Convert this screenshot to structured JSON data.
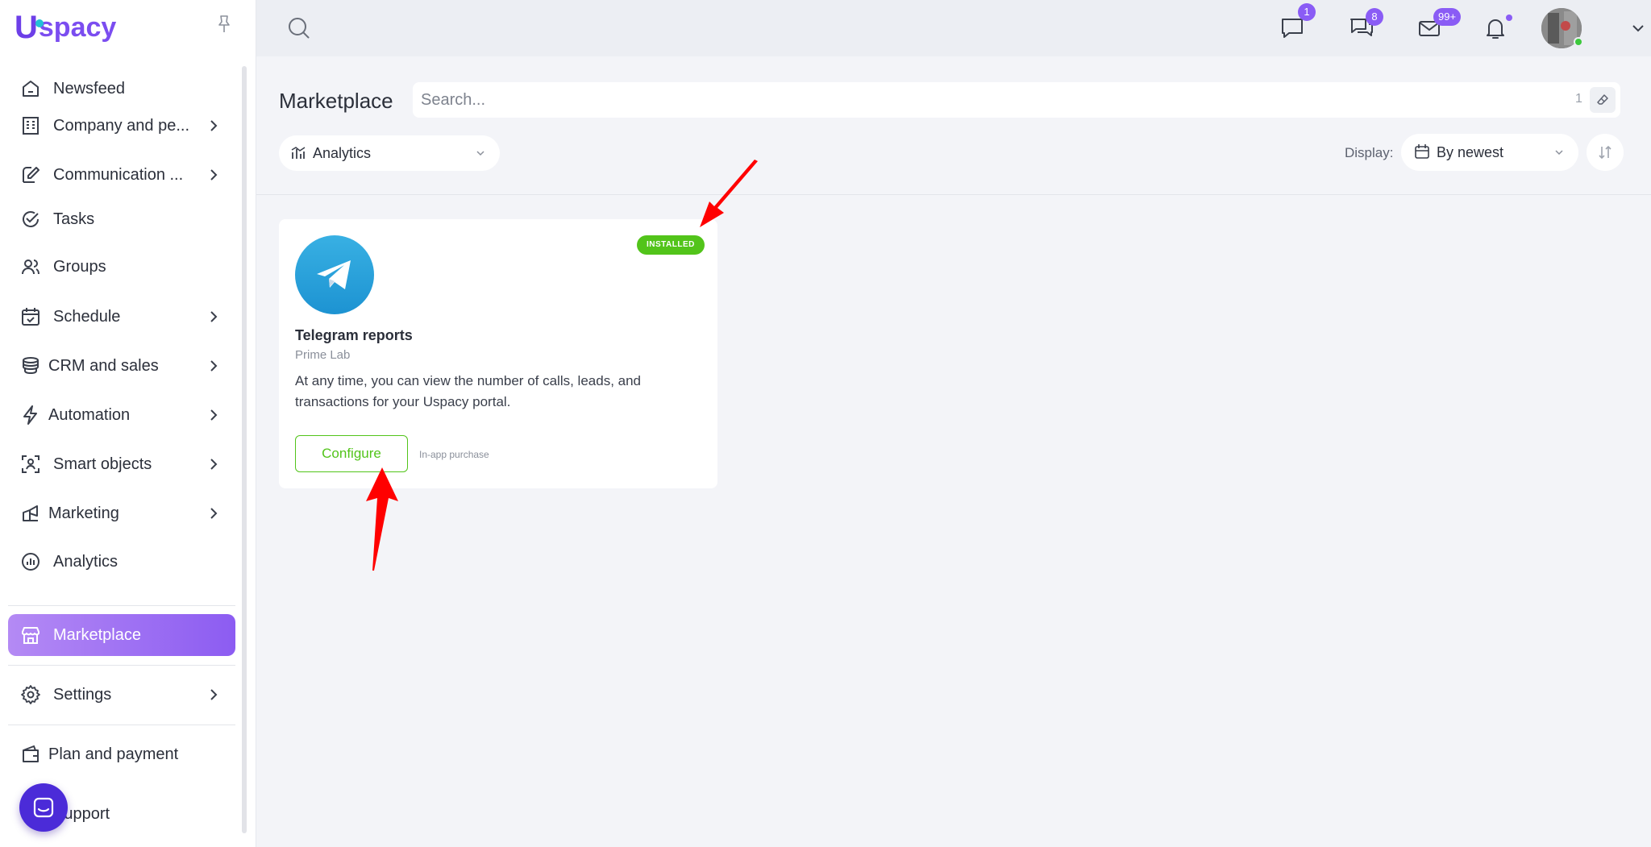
{
  "brand": {
    "logo_text": "Uspacy"
  },
  "sidebar": {
    "items": [
      {
        "label": "Newsfeed",
        "icon": "home-icon"
      },
      {
        "label": "Company and pe...",
        "icon": "building-icon"
      },
      {
        "label": "Communication ...",
        "icon": "pen-chat-icon"
      },
      {
        "label": "Tasks",
        "icon": "check-circle-icon"
      },
      {
        "label": "Groups",
        "icon": "users-icon"
      },
      {
        "label": "Schedule",
        "icon": "calendar-check-icon"
      },
      {
        "label": "CRM and sales",
        "icon": "coins-icon"
      },
      {
        "label": "Automation",
        "icon": "lightning-icon"
      },
      {
        "label": "Smart objects",
        "icon": "scan-user-icon"
      },
      {
        "label": "Marketing",
        "icon": "marketing-icon"
      },
      {
        "label": "Analytics",
        "icon": "chart-circle-icon"
      },
      {
        "label": "Marketplace",
        "icon": "store-icon"
      },
      {
        "label": "Settings",
        "icon": "gear-icon"
      },
      {
        "label": "Plan and payment",
        "icon": "wallet-icon"
      },
      {
        "label": "Support",
        "icon": "support-icon"
      }
    ]
  },
  "topbar": {
    "chat_badge": "1",
    "messenger_badge": "8",
    "mail_badge": "99+"
  },
  "page": {
    "title": "Marketplace",
    "search_placeholder": "Search...",
    "search_count": "1",
    "filter_value": "Analytics",
    "display_label": "Display:",
    "sort_value": "By newest"
  },
  "card": {
    "status": "INSTALLED",
    "name": "Telegram reports",
    "vendor": "Prime Lab",
    "description": "At any time, you can view the number of calls, leads, and transactions for your Uspacy portal.",
    "button": "Configure",
    "purchase_note": "In-app purchase"
  },
  "colors": {
    "accent": "#8a5cf5",
    "installed": "#52c41a",
    "annotation_arrow": "#ff0000"
  }
}
